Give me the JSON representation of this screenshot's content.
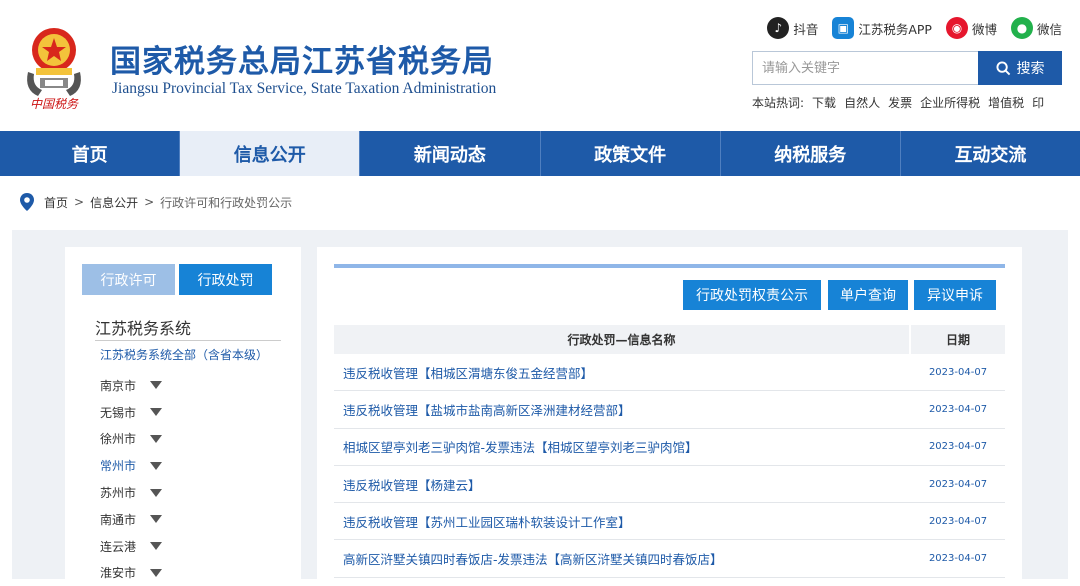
{
  "header": {
    "title_cn": "国家税务总局江苏省税务局",
    "title_en": "Jiangsu Provincial Tax Service, State Taxation Administration",
    "emblem_caption": "中国税务",
    "social": [
      {
        "label": "抖音",
        "icon": "douyin-icon",
        "color": "#222222"
      },
      {
        "label": "江苏税务APP",
        "icon": "app-icon",
        "color": "#1783d6"
      },
      {
        "label": "微博",
        "icon": "weibo-icon",
        "color": "#e6162d"
      },
      {
        "label": "微信",
        "icon": "wechat-icon",
        "color": "#22b14c"
      }
    ],
    "search_placeholder": "请输入关键字",
    "search_button": "搜索",
    "hotwords_label": "本站热词:",
    "hotwords": [
      "下载",
      "自然人",
      "发票",
      "企业所得税",
      "增值税",
      "印"
    ]
  },
  "nav": {
    "items": [
      "首页",
      "信息公开",
      "新闻动态",
      "政策文件",
      "纳税服务",
      "互动交流"
    ],
    "active_index": 1
  },
  "breadcrumb": {
    "items": [
      "首页",
      "信息公开",
      "行政许可和行政处罚公示"
    ],
    "separator": ">"
  },
  "sidebar": {
    "tabs": [
      "行政许可",
      "行政处罚"
    ],
    "active_tab": 1,
    "heading": "江苏税务系统",
    "all_label": "江苏税务系统全部（含省本级）",
    "cities": [
      "南京市",
      "无锡市",
      "徐州市",
      "常州市",
      "苏州市",
      "南通市",
      "连云港",
      "淮安市"
    ]
  },
  "content": {
    "buttons": [
      "行政处罚权责公示",
      "单户查询",
      "异议申诉"
    ],
    "table": {
      "columns": [
        "行政处罚—信息名称",
        "日期"
      ],
      "rows": [
        {
          "name": "违反税收管理【相城区渭塘东俊五金经营部】",
          "date": "2023-04-07"
        },
        {
          "name": "违反税收管理【盐城市盐南高新区泽洲建材经营部】",
          "date": "2023-04-07"
        },
        {
          "name": "相城区望亭刘老三驴肉馆-发票违法【相城区望亭刘老三驴肉馆】",
          "date": "2023-04-07"
        },
        {
          "name": "违反税收管理【杨建云】",
          "date": "2023-04-07"
        },
        {
          "name": "违反税收管理【苏州工业园区瑞朴软装设计工作室】",
          "date": "2023-04-07"
        },
        {
          "name": "高新区浒墅关镇四时春饭店-发票违法【高新区浒墅关镇四时春饭店】",
          "date": "2023-04-07"
        }
      ]
    }
  },
  "colors": {
    "brand_blue": "#1e5aa8",
    "tab_blue": "#1783d6",
    "tab_light": "#9dbfe6",
    "nav_active_bg": "#e8eef7"
  }
}
